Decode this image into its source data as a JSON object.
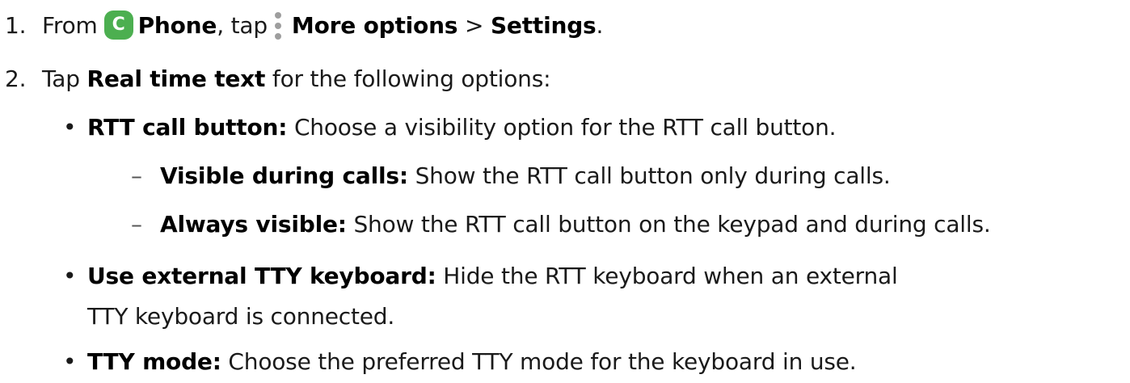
{
  "steps": [
    {
      "number": "1.",
      "parts": {
        "from": "From",
        "phone_icon_letter": "C",
        "phone": "Phone",
        "comma_tap": ", tap",
        "more_options": "More options",
        "sep": " > ",
        "settings": "Settings",
        "end": "."
      }
    },
    {
      "number": "2.",
      "parts": {
        "tap": "Tap",
        "real_time_text": "Real time text",
        "rest": " for the following options:"
      }
    }
  ],
  "options": [
    {
      "bullet": "•",
      "term": "RTT call button",
      "colon": ":",
      "desc": " Choose a visibility option for the RTT call button.",
      "sub": [
        {
          "dash": "–",
          "term": "Visible during calls",
          "colon": ":",
          "desc": " Show the RTT call button only during calls."
        },
        {
          "dash": "–",
          "term": "Always visible",
          "colon": ":",
          "desc": " Show the RTT call button on the keypad and during calls."
        }
      ]
    },
    {
      "bullet": "•",
      "term": "Use external TTY keyboard",
      "colon": ":",
      "desc": " Hide the RTT keyboard when an external",
      "desc_cont": "TTY keyboard is connected."
    },
    {
      "bullet": "•",
      "term": "TTY mode",
      "colon": ":",
      "desc": " Choose the preferred TTY mode for the keyboard in use."
    }
  ],
  "icons": {
    "phone_app": "phone-app-icon",
    "more_options": "more-options-icon",
    "phone_icon_color": "#4caf50",
    "more_icon_color": "#9e9e9e"
  }
}
